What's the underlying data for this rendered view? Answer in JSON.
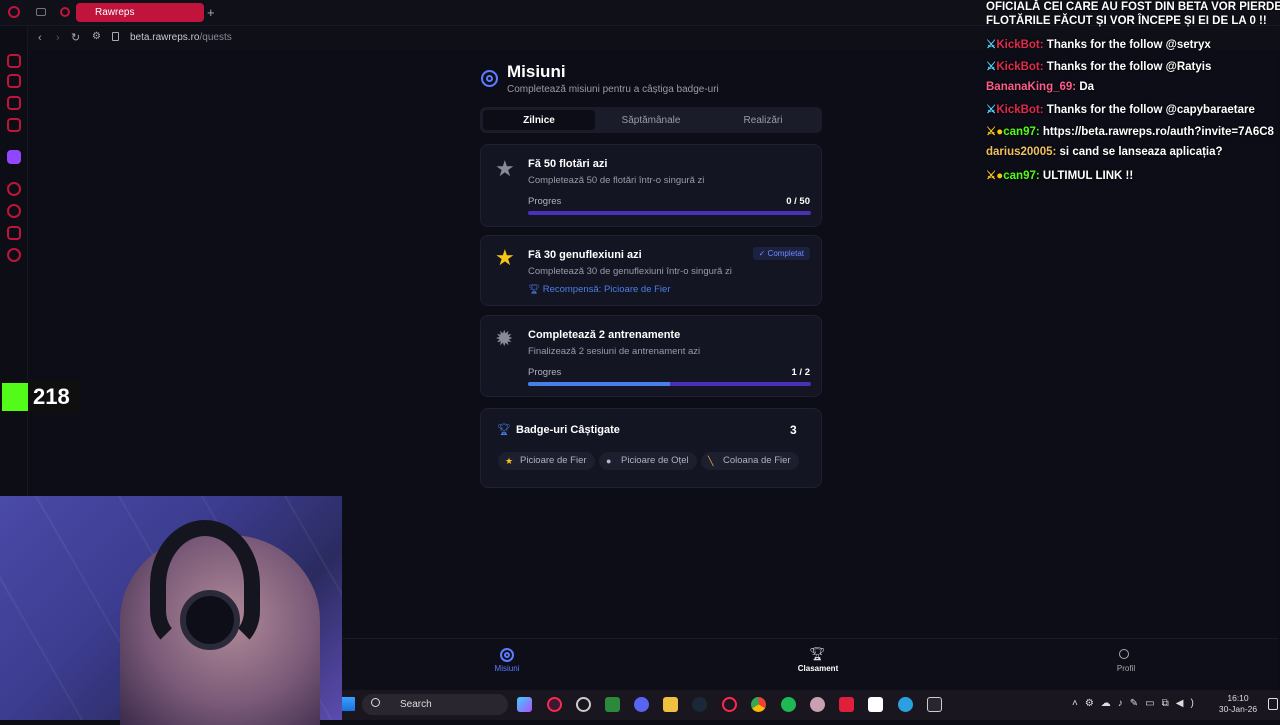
{
  "browser": {
    "tab_title": "Rawreps",
    "new_tab": "+",
    "url_host": "beta.rawreps.ro",
    "url_path": "/quests"
  },
  "page": {
    "title": "Misiuni",
    "subtitle": "Completează misiuni pentru a câștiga badge-uri",
    "tabs": [
      "Zilnice",
      "Săptămânale",
      "Realizări"
    ],
    "active_tab": "Zilnice",
    "quests": [
      {
        "title": "Fă 50 flotări azi",
        "desc": "Completează 50 de flotări într-o singură zi",
        "progress_label": "Progres",
        "progress_text": "0 / 50",
        "progress": 0.0,
        "icon": "star-icon",
        "completed": false
      },
      {
        "title": "Fă 30 genuflexiuni azi",
        "desc": "Completează 30 de genuflexiuni într-o singură zi",
        "status": "✓ Completat",
        "reward": "Recompensă: Picioare de Fier",
        "icon": "star-icon",
        "completed": true
      },
      {
        "title": "Completează 2 antrenamente",
        "desc": "Finalizează 2 sesiuni de antrenament azi",
        "progress_label": "Progres",
        "progress_text": "1 / 2",
        "progress": 0.5,
        "icon": "badge-icon",
        "completed": false
      }
    ],
    "badges": {
      "title": "Badge-uri Câștigate",
      "count": "3",
      "items": [
        {
          "label": "Picioare de Fier",
          "icon": "star-icon"
        },
        {
          "label": "Picioare de Oțel",
          "icon": "medal-icon"
        },
        {
          "label": "Coloana de Fier",
          "icon": "bone-icon"
        }
      ]
    }
  },
  "bottom_nav": [
    {
      "label": "Misiuni",
      "icon": "target-icon",
      "active": true
    },
    {
      "label": "Clasament",
      "icon": "trophy-icon",
      "active": false
    },
    {
      "label": "Profil",
      "icon": "user-icon",
      "active": false
    }
  ],
  "taskbar": {
    "search_label": "Search",
    "time": "16:10",
    "date": "30-Jan-26"
  },
  "overlay": {
    "kick_viewers": "218",
    "chat_header_1": "OFICIALĂ CEI CARE AU FOST DIN BETA VOR PIERDE",
    "chat_header_2": "FLOTĂRILE FĂCUT ȘI VOR ÎNCEPE ȘI EI DE LA 0 !!",
    "chat": [
      {
        "user": "KickBot:",
        "msg": "Thanks for the follow @setryx",
        "color": "#e02a4a"
      },
      {
        "user": "KickBot:",
        "msg": "Thanks for the follow @Ratyis",
        "color": "#e02a4a"
      },
      {
        "user": "BananaKing_69:",
        "msg": "Da",
        "color": "#ff5c8a"
      },
      {
        "user": "KickBot:",
        "msg": "Thanks for the follow @capybaraetare",
        "color": "#e02a4a"
      },
      {
        "user": "can97:",
        "msg": "https://beta.rawreps.ro/auth?invite=7A6C8",
        "color": "#53fc18"
      },
      {
        "user": "darius20005:",
        "msg": "si cand se lanseaza aplicația?",
        "color": "#f0c060"
      },
      {
        "user": "can97:",
        "msg": "ULTIMUL LINK !!",
        "color": "#53fc18"
      }
    ]
  },
  "colors": {
    "accent": "#5b7cff",
    "brand": "#c0143c",
    "progress_track": "#4a2fb8",
    "progress_fill": "#4a7ee8",
    "kick_green": "#53fc18"
  }
}
